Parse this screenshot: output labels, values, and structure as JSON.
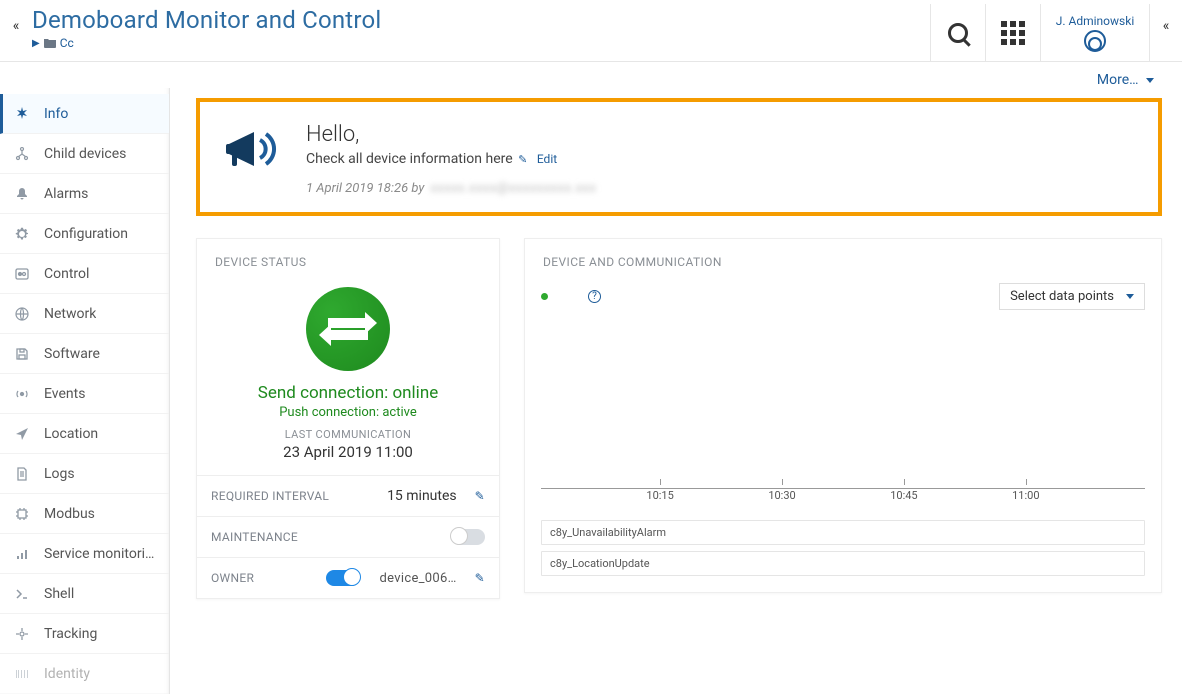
{
  "header": {
    "title": "Demoboard Monitor and Control",
    "breadcrumb": {
      "label": "Cc"
    },
    "user_name": "J. Adminowski",
    "more_label": "More…"
  },
  "sidebar": {
    "items": [
      {
        "id": "info",
        "label": "Info",
        "active": true
      },
      {
        "id": "child-devices",
        "label": "Child devices"
      },
      {
        "id": "alarms",
        "label": "Alarms"
      },
      {
        "id": "configuration",
        "label": "Configuration"
      },
      {
        "id": "control",
        "label": "Control"
      },
      {
        "id": "network",
        "label": "Network"
      },
      {
        "id": "software",
        "label": "Software"
      },
      {
        "id": "events",
        "label": "Events"
      },
      {
        "id": "location",
        "label": "Location"
      },
      {
        "id": "logs",
        "label": "Logs"
      },
      {
        "id": "modbus",
        "label": "Modbus"
      },
      {
        "id": "service-mon",
        "label": "Service monitori…"
      },
      {
        "id": "shell",
        "label": "Shell"
      },
      {
        "id": "tracking",
        "label": "Tracking"
      },
      {
        "id": "identity",
        "label": "Identity"
      }
    ]
  },
  "banner": {
    "title": "Hello,",
    "subtitle": "Check all device information here",
    "edit_label": "Edit",
    "meta_prefix": "1 April 2019 18:26 by",
    "meta_author_blurred": "xxxxx.xxxx@xxxxxxxxx.xxx"
  },
  "status_card": {
    "header": "DEVICE STATUS",
    "send_line": "Send connection: online",
    "push_line": "Push connection: active",
    "last_comm_label": "LAST COMMUNICATION",
    "last_comm_value": "23 April 2019 11:00",
    "required_interval_label": "REQUIRED INTERVAL",
    "required_interval_value": "15 minutes",
    "maintenance_label": "MAINTENANCE",
    "maintenance_on": false,
    "owner_label": "OWNER",
    "owner_on": true,
    "owner_value": "device_006…"
  },
  "comm_card": {
    "header": "DEVICE AND COMMUNICATION",
    "select_label": "Select data points",
    "time_ticks": [
      "10:15",
      "10:30",
      "10:45",
      "11:00"
    ],
    "metrics": [
      "c8y_UnavailabilityAlarm",
      "c8y_LocationUpdate"
    ]
  }
}
